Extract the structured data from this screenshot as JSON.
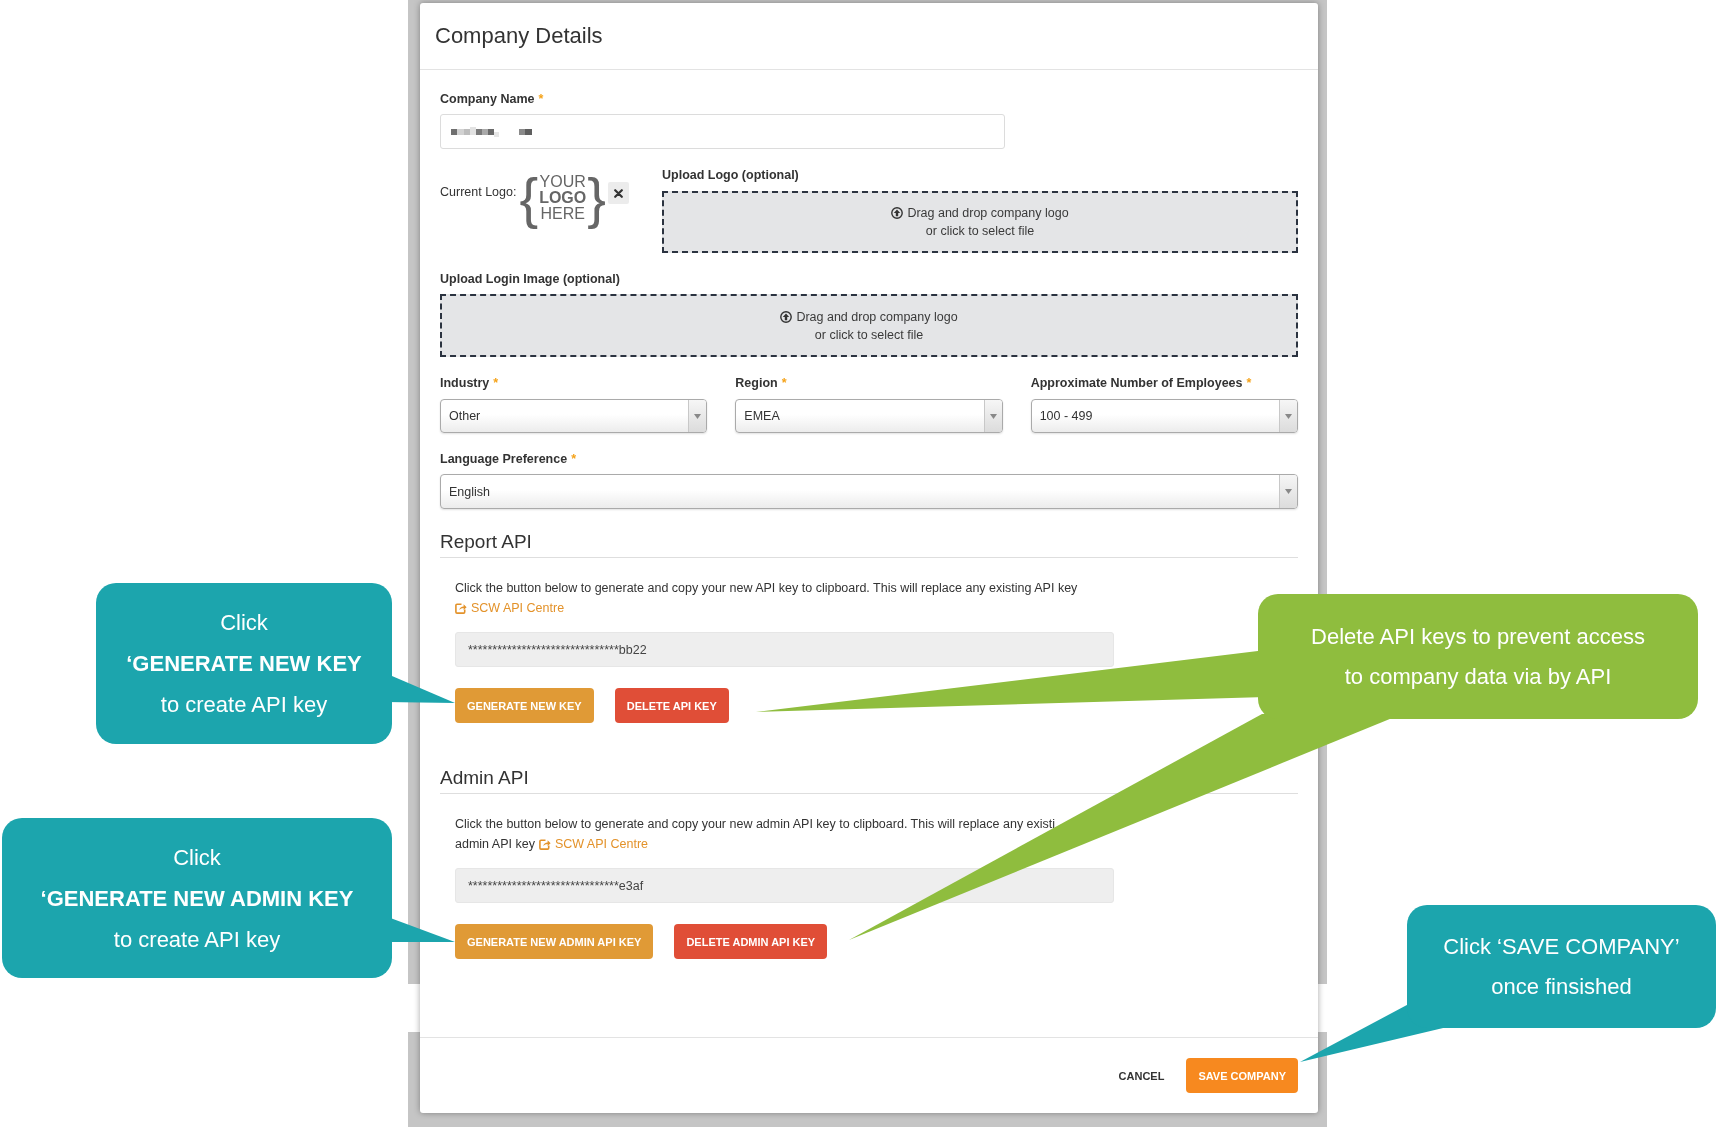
{
  "dialog": {
    "title": "Company Details",
    "company_name": {
      "label": "Company Name",
      "required_mark": "*"
    },
    "current_logo": {
      "label": "Current Logo:",
      "logo": {
        "left_brace": "{",
        "text": "YOUR\n**LOGO**\nHERE",
        "right_brace": "}"
      }
    },
    "upload_logo": {
      "label": "Upload Logo (optional)",
      "prompt": "Drag and drop company logo",
      "hint": "or click to select file"
    },
    "upload_login_image": {
      "label": "Upload Login Image (optional)",
      "prompt": "Drag and drop company logo",
      "hint": "or click to select file"
    },
    "selects": [
      {
        "label": "Industry",
        "required_mark": "*",
        "value": "Other"
      },
      {
        "label": "Region",
        "required_mark": "*",
        "value": "EMEA"
      },
      {
        "label": "Approximate Number of Employees",
        "required_mark": "*",
        "value": "100 - 499"
      }
    ],
    "language": {
      "label": "Language Preference",
      "required_mark": "*",
      "value": "English"
    },
    "api_sections": [
      {
        "heading": "Report API",
        "description": [
          {
            "text": "Click the button below to generate and copy your new API key to clipboard. This will replace any existing API key"
          },
          {
            "link": "SCW API Centre"
          }
        ],
        "key": "*******************************bb22",
        "buttons": [
          {
            "label": "GENERATE NEW KEY",
            "kind": "generate"
          },
          {
            "label": "DELETE API KEY",
            "kind": "delete"
          }
        ]
      },
      {
        "heading": "Admin API",
        "description": [
          {
            "text": "Click the button below to generate and copy your new admin API key to clipboard. This will replace any existi"
          },
          {
            "text": "admin API key",
            "link": "SCW API Centre"
          }
        ],
        "key": "*******************************e3af",
        "buttons": [
          {
            "label": "GENERATE NEW ADMIN API KEY",
            "kind": "generate"
          },
          {
            "label": "DELETE ADMIN API KEY",
            "kind": "delete"
          }
        ]
      }
    ],
    "footer_buttons": [
      {
        "label": "CANCEL",
        "kind": "cancel"
      },
      {
        "label": "SAVE COMPANY",
        "kind": "save"
      }
    ]
  },
  "callouts": [
    {
      "text": "Click\n**‘GENERATE NEW KEY**\nto create API key",
      "color": "#1ca5ad"
    },
    {
      "text": "Click\n**‘GENERATE NEW ADMIN KEY**\nto create API key",
      "color": "#1ca5ad"
    },
    {
      "text": "Delete API keys to prevent access\nto company data via by API",
      "color": "#8fbd3e"
    },
    {
      "text": "Click ‘SAVE COMPANY’\nonce finsished",
      "color": "#1ca5ad"
    }
  ]
}
